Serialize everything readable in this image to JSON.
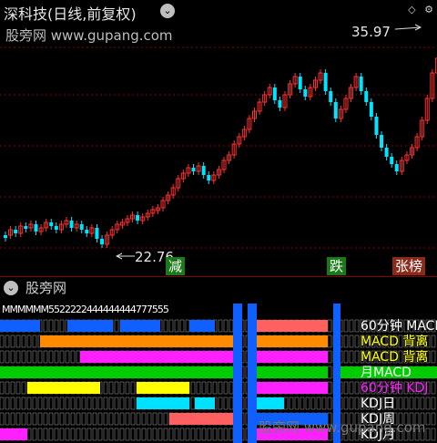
{
  "title": "深科技(日线,前复权)",
  "title_toggle_icon": "chevron-down-icon",
  "top_right_icons": [
    "diamond-icon",
    "settings-icon"
  ],
  "watermark_top": "股旁网 www.gupang.com",
  "high_label": "35.97",
  "low_label": "22.76",
  "signal_tags": {
    "reduce": "减",
    "fall": "跌",
    "rise": "张榜"
  },
  "panel2": {
    "title": "股旁网",
    "toggle_icon": "chevron-down-icon",
    "indicator_labels": [
      "60分钟 MACD",
      "MACD 背离",
      "MACD 背离",
      "月MACD",
      "60分钟 KDJ",
      "KDJ日",
      "KDJ周",
      "KDJ月"
    ],
    "overlap_text": "MMMMMM5522222444444444777555",
    "watermark": "股旁网 www.gupang.com"
  },
  "colors": {
    "up": "#ff3030",
    "down": "#00e5ff",
    "grid": "#8a0000",
    "blue": "#1060ff",
    "orange": "#ff8c00",
    "yellow": "#ffff00",
    "magenta": "#ff20ff",
    "green": "#00cc00",
    "cyan": "#00e0ff",
    "salmon": "#ff6060"
  }
}
